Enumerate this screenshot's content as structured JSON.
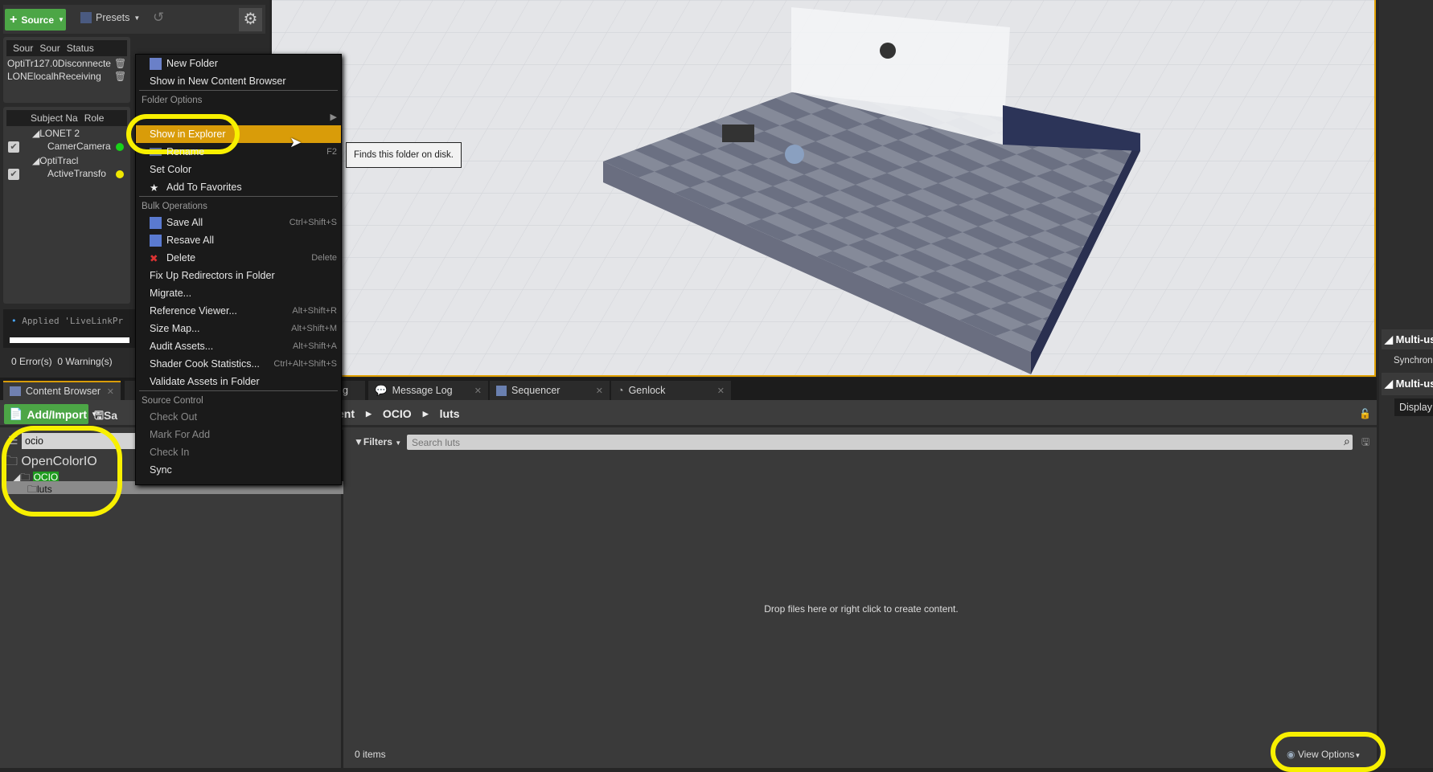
{
  "livelink": {
    "source_button": "Source",
    "presets_button": "Presets",
    "sources_headers": [
      "Sour",
      "Sour",
      "Status"
    ],
    "sources": [
      {
        "name": "OptiTr",
        "address": "127.0",
        "status": "Disconnecte"
      },
      {
        "name": "LONE",
        "address": "localh",
        "status": "Receiving"
      }
    ],
    "subjects_headers": [
      "Subject Na",
      "Role"
    ],
    "subjects": [
      {
        "group": "LONET 2",
        "name": "Camer",
        "role": "Camera",
        "status_color": "#19d319"
      },
      {
        "group": "OptiTracl",
        "name": "Active",
        "role": "Transfo",
        "status_color": "#f0e800"
      }
    ],
    "log_line": "Applied 'LiveLinkPr",
    "errors": "0 Error(s)",
    "warnings": "0 Warning(s)"
  },
  "tabs": [
    {
      "label": "Content Browser"
    },
    {
      "label": "g"
    },
    {
      "label": "Message Log"
    },
    {
      "label": "Sequencer"
    },
    {
      "label": "Genlock"
    }
  ],
  "content_browser": {
    "add_import": "Add/Import",
    "save_label": "Sa",
    "breadcrumb": [
      "ent",
      "OCIO",
      "luts"
    ],
    "folder_search_value": "ocio",
    "tree": [
      {
        "label": "OpenColorIO"
      },
      {
        "label": "OCIO",
        "highlight": "#1e9a1e"
      },
      {
        "label": "luts",
        "selected": true
      }
    ],
    "filters": "Filters",
    "search_placeholder": "Search luts",
    "empty_message": "Drop files here or right click to create content.",
    "item_count": "0 items",
    "view_options": "View Options"
  },
  "context_menu": {
    "top": [
      {
        "label": "New Folder",
        "icon": "new-folder-icon"
      },
      {
        "label": "Show in New Content Browser"
      }
    ],
    "folder_options_header": "Folder Options",
    "folder_options": [
      {
        "label": "Show in Explorer",
        "highlighted": true
      },
      {
        "label": "Rename",
        "shortcut": "F2",
        "icon": "rename-icon"
      },
      {
        "label": "Set Color"
      },
      {
        "label": "Add To Favorites",
        "icon": "star-icon"
      }
    ],
    "bulk_header": "Bulk Operations",
    "bulk": [
      {
        "label": "Save All",
        "shortcut": "Ctrl+Shift+S",
        "icon": "save-icon"
      },
      {
        "label": "Resave All",
        "icon": "save-icon"
      },
      {
        "label": "Delete",
        "shortcut": "Delete",
        "icon": "delete-icon"
      },
      {
        "label": "Fix Up Redirectors in Folder"
      },
      {
        "label": "Migrate..."
      },
      {
        "label": "Reference Viewer...",
        "shortcut": "Alt+Shift+R"
      },
      {
        "label": "Size Map...",
        "shortcut": "Alt+Shift+M"
      },
      {
        "label": "Audit Assets...",
        "shortcut": "Alt+Shift+A"
      },
      {
        "label": "Shader Cook Statistics...",
        "shortcut": "Ctrl+Alt+Shift+S"
      },
      {
        "label": "Validate Assets in Folder"
      }
    ],
    "source_control_header": "Source Control",
    "source_control": [
      {
        "label": "Check Out",
        "disabled": true
      },
      {
        "label": "Mark For Add",
        "disabled": true
      },
      {
        "label": "Check In",
        "disabled": true
      },
      {
        "label": "Sync"
      }
    ]
  },
  "tooltip": "Finds this folder on disk.",
  "right_panel": {
    "header1": "Multi-us",
    "item1": "Synchron",
    "header2": "Multi-us",
    "button": "Display"
  },
  "colors": {
    "accent": "#d99c09",
    "highlight_ring": "#f8f000",
    "green_button": "#4ca646"
  }
}
